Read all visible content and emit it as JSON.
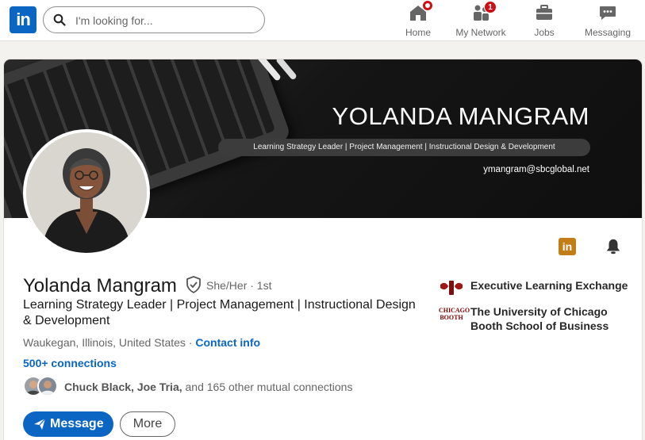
{
  "nav": {
    "logo": "in",
    "search_placeholder": "I'm looking for...",
    "items": [
      {
        "label": "Home"
      },
      {
        "label": "My Network",
        "badge": "1"
      },
      {
        "label": "Jobs"
      },
      {
        "label": "Messaging"
      }
    ]
  },
  "banner": {
    "name": "YOLANDA MANGRAM",
    "tagline": "Learning Strategy Leader | Project Management | Instructional Design & Development",
    "email": "ymangram@sbcglobal.net"
  },
  "profile": {
    "name": "Yolanda Mangram",
    "pronoun_degree": "She/Her · 1st",
    "headline": "Learning Strategy Leader | Project Management | Instructional Design & Development",
    "location": "Waukegan, Illinois, United States · ",
    "contact_label": "Contact info",
    "connections": "500+ connections",
    "mutual_names": "Chuck Black, Joe Tria,",
    "mutual_rest": " and 165 other mutual connections",
    "message_label": "Message",
    "more_label": "More",
    "action_logo": "in"
  },
  "experience": [
    {
      "name": "Executive Learning Exchange"
    },
    {
      "name": "The University of Chicago Booth School of Business"
    }
  ],
  "school_logo_text": "CHICAGO BOOTH",
  "colors": {
    "brand_blue": "#0a66c2",
    "notification_red": "#cc1016",
    "premium_gold": "#c37d16"
  }
}
